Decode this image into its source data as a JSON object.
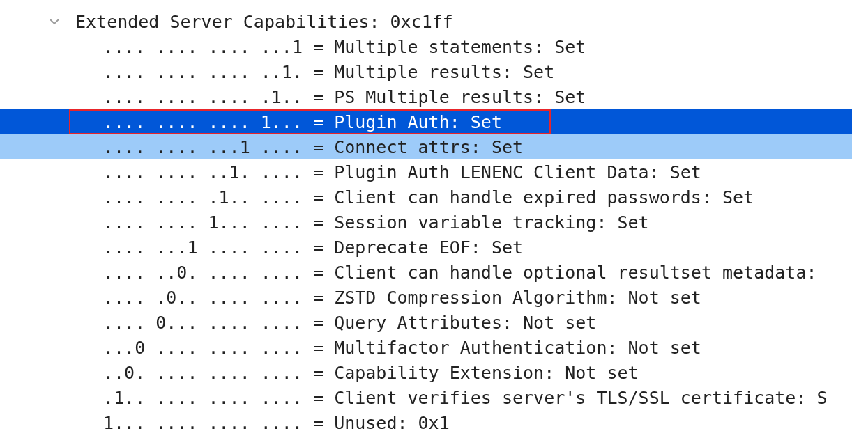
{
  "tree": [
    {
      "label": "Extended Server Capabilities: 0xc1ff",
      "expanded": true,
      "children": [
        {
          "label": ".... .... .... ...1 = Multiple statements: Set",
          "selected": false,
          "highlighted": false,
          "annotated": false
        },
        {
          "label": ".... .... .... ..1. = Multiple results: Set",
          "selected": false,
          "highlighted": false,
          "annotated": false
        },
        {
          "label": ".... .... .... .1.. = PS Multiple results: Set",
          "selected": false,
          "highlighted": false,
          "annotated": false
        },
        {
          "label": ".... .... .... 1... = Plugin Auth: Set",
          "selected": true,
          "highlighted": false,
          "annotated": true
        },
        {
          "label": ".... .... ...1 .... = Connect attrs: Set",
          "selected": false,
          "highlighted": true,
          "annotated": false
        },
        {
          "label": ".... .... ..1. .... = Plugin Auth LENENC Client Data: Set",
          "selected": false,
          "highlighted": false,
          "annotated": false
        },
        {
          "label": ".... .... .1.. .... = Client can handle expired passwords: Set",
          "selected": false,
          "highlighted": false,
          "annotated": false
        },
        {
          "label": ".... .... 1... .... = Session variable tracking: Set",
          "selected": false,
          "highlighted": false,
          "annotated": false
        },
        {
          "label": ".... ...1 .... .... = Deprecate EOF: Set",
          "selected": false,
          "highlighted": false,
          "annotated": false
        },
        {
          "label": ".... ..0. .... .... = Client can handle optional resultset metadata:",
          "selected": false,
          "highlighted": false,
          "annotated": false
        },
        {
          "label": ".... .0.. .... .... = ZSTD Compression Algorithm: Not set",
          "selected": false,
          "highlighted": false,
          "annotated": false
        },
        {
          "label": ".... 0... .... .... = Query Attributes: Not set",
          "selected": false,
          "highlighted": false,
          "annotated": false
        },
        {
          "label": "...0 .... .... .... = Multifactor Authentication: Not set",
          "selected": false,
          "highlighted": false,
          "annotated": false
        },
        {
          "label": "..0. .... .... .... = Capability Extension: Not set",
          "selected": false,
          "highlighted": false,
          "annotated": false
        },
        {
          "label": ".1.. .... .... .... = Client verifies server's TLS/SSL certificate: S",
          "selected": false,
          "highlighted": false,
          "annotated": false
        },
        {
          "label": "1... .... .... .... = Unused: 0x1",
          "selected": false,
          "highlighted": false,
          "annotated": false
        }
      ]
    }
  ]
}
